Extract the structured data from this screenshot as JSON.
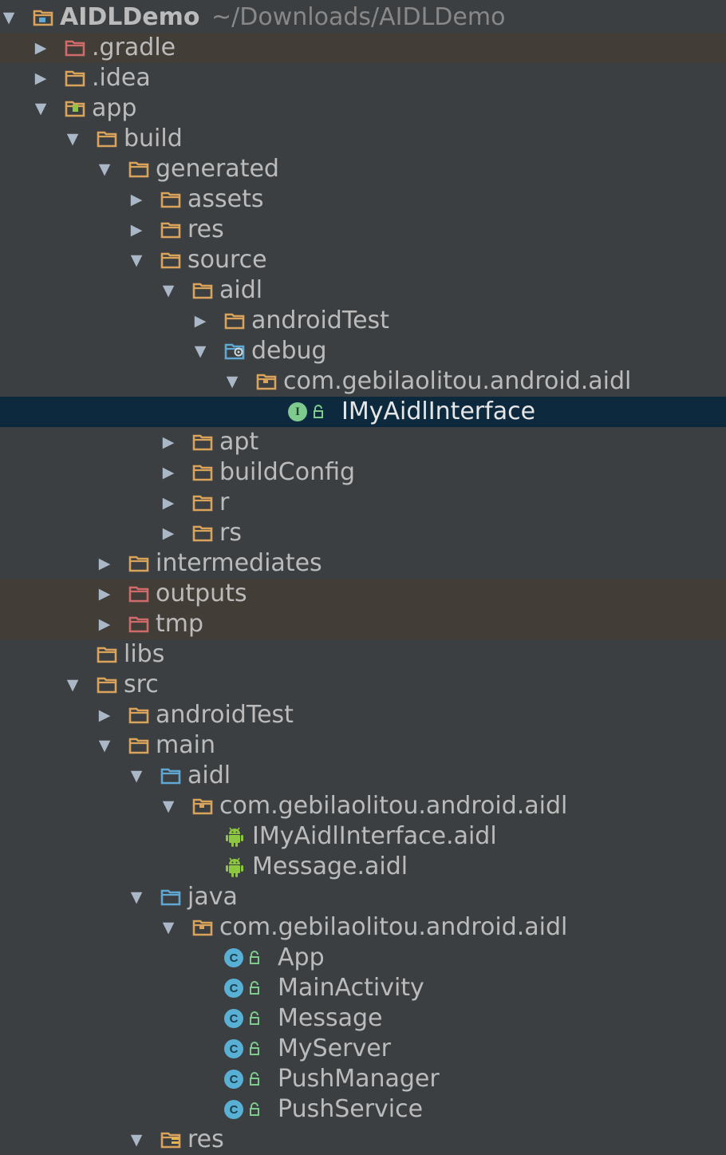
{
  "project_tree": {
    "rows": [
      {
        "label": "AIDLDemo",
        "suffix": "~/Downloads/AIDLDemo",
        "depth": 0,
        "arrow": "expanded",
        "icon": "module-folder-icon",
        "state": "normal"
      },
      {
        "label": ".gradle",
        "depth": 1,
        "arrow": "collapsed",
        "icon": "excluded-folder-icon",
        "state": "excluded"
      },
      {
        "label": ".idea",
        "depth": 1,
        "arrow": "collapsed",
        "icon": "folder-icon",
        "state": "normal"
      },
      {
        "label": "app",
        "depth": 1,
        "arrow": "expanded",
        "icon": "android-module-icon",
        "state": "normal"
      },
      {
        "label": "build",
        "depth": 2,
        "arrow": "expanded",
        "icon": "folder-icon",
        "state": "normal"
      },
      {
        "label": "generated",
        "depth": 3,
        "arrow": "expanded",
        "icon": "folder-icon",
        "state": "normal"
      },
      {
        "label": "assets",
        "depth": 4,
        "arrow": "collapsed",
        "icon": "folder-icon",
        "state": "normal"
      },
      {
        "label": "res",
        "depth": 4,
        "arrow": "collapsed",
        "icon": "folder-icon",
        "state": "normal"
      },
      {
        "label": "source",
        "depth": 4,
        "arrow": "expanded",
        "icon": "folder-icon",
        "state": "normal"
      },
      {
        "label": "aidl",
        "depth": 5,
        "arrow": "expanded",
        "icon": "folder-icon",
        "state": "normal"
      },
      {
        "label": "androidTest",
        "depth": 6,
        "arrow": "collapsed",
        "icon": "folder-icon",
        "state": "normal"
      },
      {
        "label": "debug",
        "depth": 6,
        "arrow": "expanded",
        "icon": "generated-source-folder-icon",
        "state": "normal"
      },
      {
        "label": "com.gebilaolitou.android.aidl",
        "depth": 7,
        "arrow": "expanded",
        "icon": "package-icon",
        "state": "normal"
      },
      {
        "label": "IMyAidlInterface",
        "depth": 8,
        "arrow": "none",
        "icon": "interface-icon",
        "state": "selected"
      },
      {
        "label": "apt",
        "depth": 5,
        "arrow": "collapsed",
        "icon": "folder-icon",
        "state": "normal"
      },
      {
        "label": "buildConfig",
        "depth": 5,
        "arrow": "collapsed",
        "icon": "folder-icon",
        "state": "normal"
      },
      {
        "label": "r",
        "depth": 5,
        "arrow": "collapsed",
        "icon": "folder-icon",
        "state": "normal"
      },
      {
        "label": "rs",
        "depth": 5,
        "arrow": "collapsed",
        "icon": "folder-icon",
        "state": "normal"
      },
      {
        "label": "intermediates",
        "depth": 3,
        "arrow": "collapsed",
        "icon": "folder-icon",
        "state": "normal"
      },
      {
        "label": "outputs",
        "depth": 3,
        "arrow": "collapsed",
        "icon": "excluded-folder-icon",
        "state": "excluded"
      },
      {
        "label": "tmp",
        "depth": 3,
        "arrow": "collapsed",
        "icon": "excluded-folder-icon",
        "state": "excluded"
      },
      {
        "label": "libs",
        "depth": 2,
        "arrow": "none",
        "icon": "folder-icon",
        "state": "normal"
      },
      {
        "label": "src",
        "depth": 2,
        "arrow": "expanded",
        "icon": "folder-icon",
        "state": "normal"
      },
      {
        "label": "androidTest",
        "depth": 3,
        "arrow": "collapsed",
        "icon": "folder-icon",
        "state": "normal"
      },
      {
        "label": "main",
        "depth": 3,
        "arrow": "expanded",
        "icon": "folder-icon",
        "state": "normal"
      },
      {
        "label": "aidl",
        "depth": 4,
        "arrow": "expanded",
        "icon": "source-folder-icon",
        "state": "normal"
      },
      {
        "label": "com.gebilaolitou.android.aidl",
        "depth": 5,
        "arrow": "expanded",
        "icon": "package-icon",
        "state": "normal"
      },
      {
        "label": "IMyAidlInterface.aidl",
        "depth": 6,
        "arrow": "none",
        "icon": "android-file-icon",
        "state": "normal"
      },
      {
        "label": "Message.aidl",
        "depth": 6,
        "arrow": "none",
        "icon": "android-file-icon",
        "state": "normal"
      },
      {
        "label": "java",
        "depth": 4,
        "arrow": "expanded",
        "icon": "source-folder-icon",
        "state": "normal"
      },
      {
        "label": "com.gebilaolitou.android.aidl",
        "depth": 5,
        "arrow": "expanded",
        "icon": "package-icon",
        "state": "normal"
      },
      {
        "label": "App",
        "depth": 6,
        "arrow": "none",
        "icon": "class-icon",
        "state": "normal"
      },
      {
        "label": "MainActivity",
        "depth": 6,
        "arrow": "none",
        "icon": "class-icon",
        "state": "normal"
      },
      {
        "label": "Message",
        "depth": 6,
        "arrow": "none",
        "icon": "class-icon",
        "state": "normal"
      },
      {
        "label": "MyServer",
        "depth": 6,
        "arrow": "none",
        "icon": "class-icon",
        "state": "normal"
      },
      {
        "label": "PushManager",
        "depth": 6,
        "arrow": "none",
        "icon": "class-icon",
        "state": "normal"
      },
      {
        "label": "PushService",
        "depth": 6,
        "arrow": "none",
        "icon": "class-icon",
        "state": "normal"
      },
      {
        "label": "res",
        "depth": 4,
        "arrow": "expanded",
        "icon": "resource-folder-icon",
        "state": "normal"
      }
    ]
  },
  "colors": {
    "background": "#3c3f41",
    "selected": "#0d293e",
    "excluded_row": "#433d38",
    "folder": "#d9a35c",
    "excluded_folder": "#d06b6b",
    "source_folder": "#5fa8d3",
    "android_green": "#8dc63f",
    "text": "#bbbbbb"
  }
}
